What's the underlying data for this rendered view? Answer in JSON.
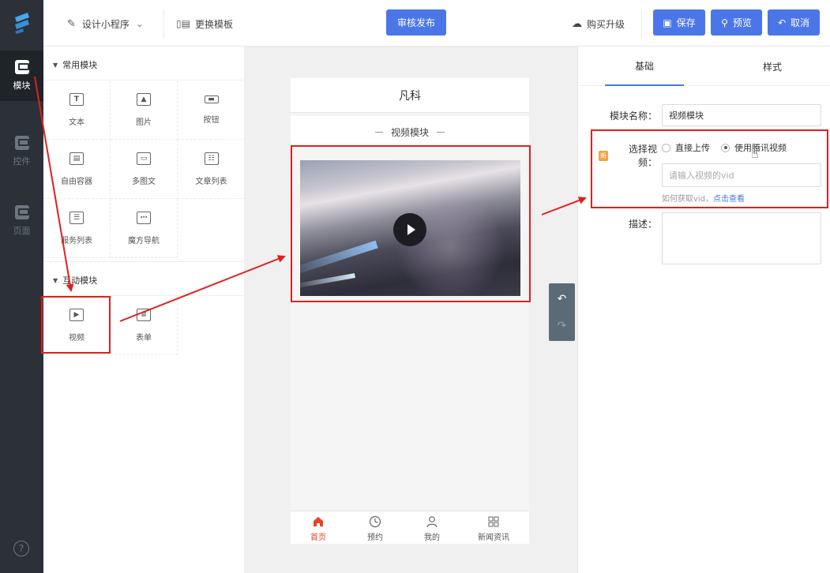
{
  "colors": {
    "accent": "#4a76e8",
    "rail": "#2b3137",
    "annotation": "#e0201d",
    "tab_active": "#e8412c"
  },
  "rail": {
    "items": [
      {
        "label": "模块",
        "icon": "module-icon",
        "active": true
      },
      {
        "label": "控件",
        "icon": "widget-icon",
        "active": false
      },
      {
        "label": "页面",
        "icon": "page-icon",
        "active": false
      }
    ],
    "help": "?"
  },
  "topbar": {
    "design_label": "设计小程序",
    "template_label": "更换模板",
    "publish_label": "审核发布",
    "upgrade_label": "购买升级",
    "save_label": "保存",
    "preview_label": "预览",
    "cancel_label": "取消"
  },
  "modules": {
    "common_title": "常用模块",
    "common": [
      {
        "label": "文本",
        "icon": "text-icon"
      },
      {
        "label": "图片",
        "icon": "image-icon"
      },
      {
        "label": "按钮",
        "icon": "button-icon"
      },
      {
        "label": "自由容器",
        "icon": "container-icon"
      },
      {
        "label": "多图文",
        "icon": "multi-image-text-icon"
      },
      {
        "label": "文章列表",
        "icon": "article-list-icon"
      },
      {
        "label": "服务列表",
        "icon": "service-list-icon"
      },
      {
        "label": "魔方导航",
        "icon": "cube-nav-icon"
      }
    ],
    "interactive_title": "互动模块",
    "interactive": [
      {
        "label": "视频",
        "icon": "video-icon"
      },
      {
        "label": "表单",
        "icon": "form-icon"
      }
    ]
  },
  "phone": {
    "title": "凡科",
    "module_title": "视频模块",
    "tabs": [
      {
        "label": "首页",
        "icon": "home-icon",
        "active": true
      },
      {
        "label": "预约",
        "icon": "clock-icon",
        "active": false
      },
      {
        "label": "我的",
        "icon": "user-icon",
        "active": false
      },
      {
        "label": "新闻资讯",
        "icon": "grid-icon",
        "active": false
      }
    ]
  },
  "props": {
    "tabs": [
      "基础",
      "样式"
    ],
    "name_label": "模块名称：",
    "name_value": "视频模块",
    "video_label": "选择视频：",
    "new_tag": "新",
    "radio_upload": "直接上传",
    "radio_tencent": "使用腾讯视频",
    "vid_placeholder": "请输入视频的vid",
    "hint_text": "如何获取vid，",
    "hint_link": "点击查看",
    "desc_label": "描述："
  }
}
